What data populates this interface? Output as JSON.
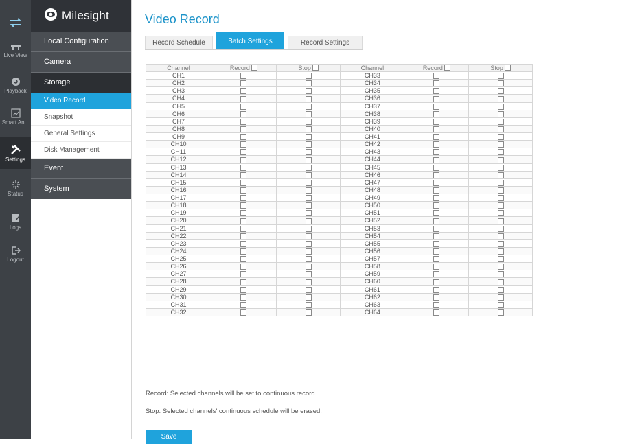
{
  "rail": {
    "items": [
      {
        "icon": "swap-arrows-icon",
        "label": ""
      },
      {
        "icon": "live-view-icon",
        "label": "Live View"
      },
      {
        "icon": "playback-icon",
        "label": "Playback"
      },
      {
        "icon": "smart-analytics-icon",
        "label": "Smart An..."
      },
      {
        "icon": "settings-icon",
        "label": "Settings"
      },
      {
        "icon": "status-icon",
        "label": "Status"
      },
      {
        "icon": "logs-icon",
        "label": "Logs"
      },
      {
        "icon": "logout-icon",
        "label": "Logout"
      }
    ]
  },
  "brand": {
    "name": "Milesight"
  },
  "menu": {
    "local_configuration": "Local Configuration",
    "camera": "Camera",
    "storage": "Storage",
    "sub": [
      "Video Record",
      "Snapshot",
      "General Settings",
      "Disk Management"
    ],
    "event": "Event",
    "system": "System"
  },
  "page": {
    "title": "Video Record"
  },
  "tabs": [
    "Record Schedule",
    "Batch Settings",
    "Record Settings"
  ],
  "table": {
    "headers": [
      "Channel",
      "Record",
      "Stop",
      "Channel",
      "Record",
      "Stop"
    ],
    "left_channels": [
      "CH1",
      "CH2",
      "CH3",
      "CH4",
      "CH5",
      "CH6",
      "CH7",
      "CH8",
      "CH9",
      "CH10",
      "CH11",
      "CH12",
      "CH13",
      "CH14",
      "CH15",
      "CH16",
      "CH17",
      "CH18",
      "CH19",
      "CH20",
      "CH21",
      "CH22",
      "CH23",
      "CH24",
      "CH25",
      "CH26",
      "CH27",
      "CH28",
      "CH29",
      "CH30",
      "CH31",
      "CH32"
    ],
    "right_channels": [
      "CH33",
      "CH34",
      "CH35",
      "CH36",
      "CH37",
      "CH38",
      "CH39",
      "CH40",
      "CH41",
      "CH42",
      "CH43",
      "CH44",
      "CH45",
      "CH46",
      "CH47",
      "CH48",
      "CH49",
      "CH50",
      "CH51",
      "CH52",
      "CH53",
      "CH54",
      "CH55",
      "CH56",
      "CH57",
      "CH58",
      "CH59",
      "CH60",
      "CH61",
      "CH62",
      "CH63",
      "CH64"
    ]
  },
  "notes": {
    "record": "Record: Selected channels will be set to continuous record.",
    "stop": "Stop: Selected channels' continuous schedule will be erased."
  },
  "buttons": {
    "save": "Save"
  },
  "colors": {
    "accent": "#1fa3dc",
    "rail": "#3d4146",
    "title": "#1c93c9"
  }
}
